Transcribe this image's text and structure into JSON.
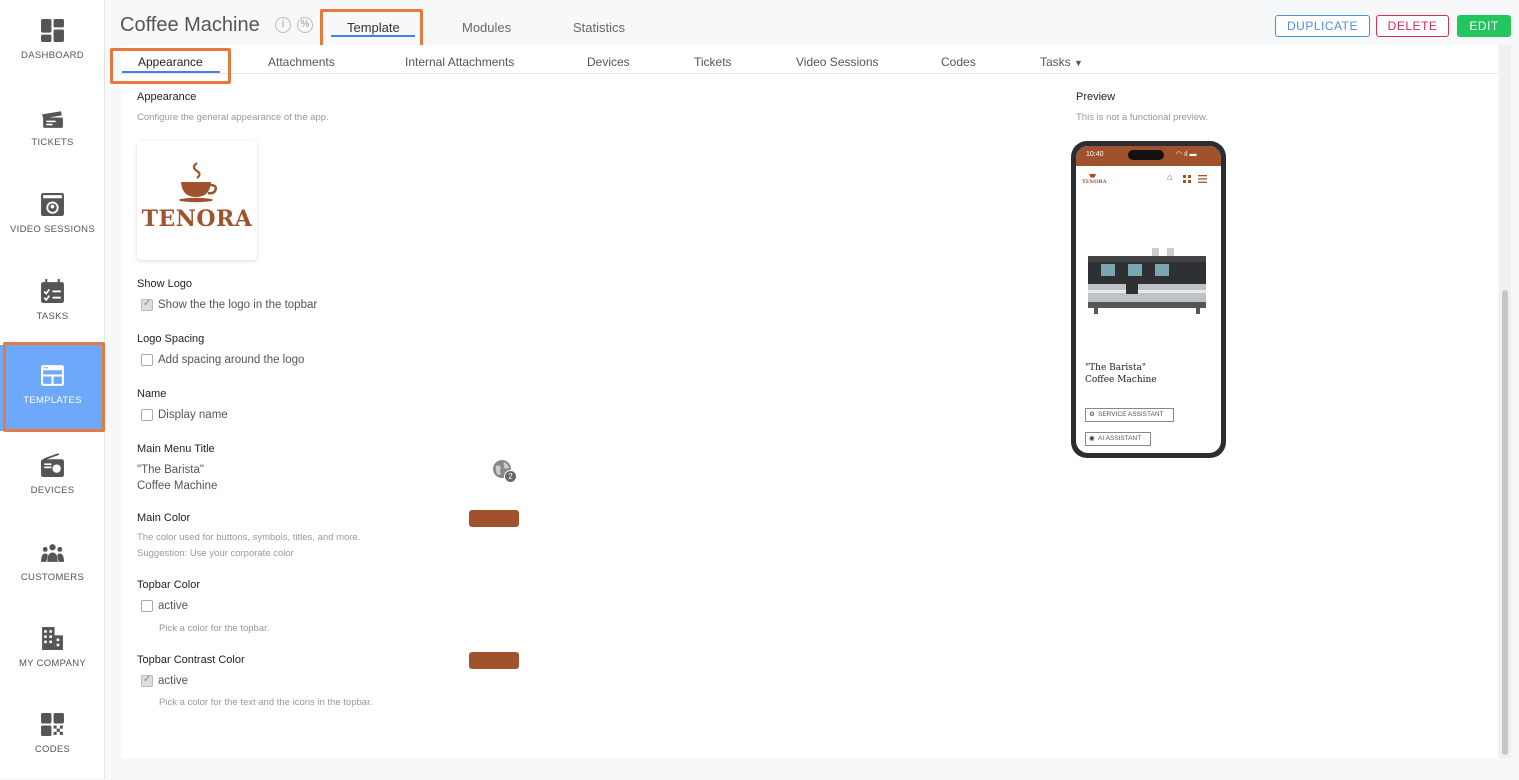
{
  "sidebar": {
    "items": [
      {
        "label": "DASHBOARD",
        "icon": "dashboard-icon"
      },
      {
        "label": "TICKETS",
        "icon": "ticket-icon"
      },
      {
        "label": "VIDEO SESSIONS",
        "icon": "video-sessions-icon"
      },
      {
        "label": "TASKS",
        "icon": "tasks-icon"
      },
      {
        "label": "TEMPLATES",
        "icon": "templates-icon"
      },
      {
        "label": "DEVICES",
        "icon": "devices-icon"
      },
      {
        "label": "CUSTOMERS",
        "icon": "customers-icon"
      },
      {
        "label": "MY COMPANY",
        "icon": "company-icon"
      },
      {
        "label": "CODES",
        "icon": "codes-icon"
      }
    ],
    "active": "TEMPLATES"
  },
  "header": {
    "title": "Coffee Machine",
    "tabs": [
      "Template",
      "Modules",
      "Statistics"
    ],
    "active_tab": "Template",
    "buttons": {
      "duplicate": "DUPLICATE",
      "delete": "DELETE",
      "edit": "EDIT"
    }
  },
  "subtabs": [
    "Appearance",
    "Attachments",
    "Internal Attachments",
    "Devices",
    "Tickets",
    "Video Sessions",
    "Codes",
    "Tasks"
  ],
  "active_subtab": "Appearance",
  "appearance": {
    "heading": "Appearance",
    "description": "Configure the general appearance of the app.",
    "logo_text": "TENORA",
    "show_logo": {
      "heading": "Show Logo",
      "label": "Show the the logo in the topbar",
      "checked": true
    },
    "logo_spacing": {
      "heading": "Logo Spacing",
      "label": "Add spacing around the logo",
      "checked": false
    },
    "name": {
      "heading": "Name",
      "label": "Display name",
      "checked": false
    },
    "main_menu_title": {
      "heading": "Main Menu Title",
      "line1": "\"The Barista\"",
      "line2": "Coffee Machine",
      "translations": "2"
    },
    "main_color": {
      "heading": "Main Color",
      "desc1": "The color used for buttons, symbols, titles, and more.",
      "desc2": "Suggestion: Use your corporate color",
      "value": "#a0522d"
    },
    "topbar_color": {
      "heading": "Topbar Color",
      "label": "active",
      "checked": false,
      "hint": "Pick a color for the topbar."
    },
    "topbar_contrast": {
      "heading": "Topbar Contrast Color",
      "label": "active",
      "checked": true,
      "hint": "Pick a color for the text and the icons in the topbar.",
      "value": "#a0522d"
    }
  },
  "preview": {
    "heading": "Preview",
    "description": "This is not a functional preview.",
    "time": "10:40",
    "brand": "TENORA",
    "title_line1": "\"The Barista\"",
    "title_line2": "Coffee Machine",
    "button1": "SERVICE ASSISTANT",
    "button2": "AI ASSISTANT"
  },
  "colors": {
    "accent": "#a0522d",
    "highlight": "#e57a3f",
    "active_nav": "#6ea8fb",
    "tab_underline": "#4a7cf0",
    "duplicate": "#4a90e2",
    "delete": "#d9304f",
    "edit": "#22c55e"
  }
}
